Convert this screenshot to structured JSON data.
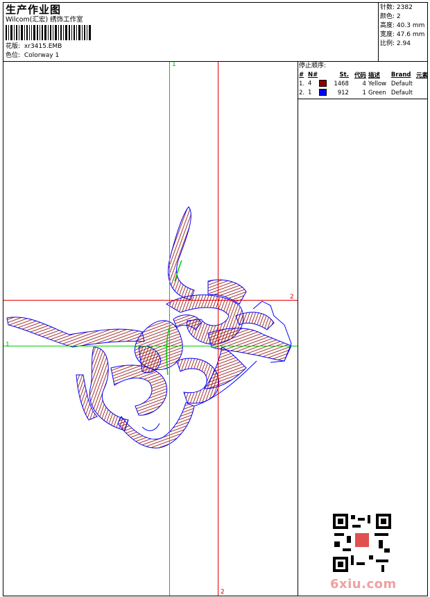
{
  "header": {
    "title": "生产作业图",
    "company": "Wilcom(汇宏) 绣饰工作室",
    "design_label": "花版:",
    "design_file": "xr3415.EMB",
    "colorway_label": "色位:",
    "colorway": "Colorway 1"
  },
  "stats": {
    "stitches_label": "针数:",
    "stitches": "2382",
    "colors_label": "颜色:",
    "colors": "2",
    "height_label": "高度:",
    "height": "40.3 mm",
    "width_label": "宽度:",
    "width": "47.6 mm",
    "scale_label": "比例:",
    "scale": "2.94"
  },
  "stop_sequence": {
    "heading": "停止顺序:",
    "columns": [
      "#",
      "N#",
      "St.",
      "代码",
      "描述",
      "Brand",
      "元素"
    ],
    "rows": [
      {
        "num": "1.",
        "n": "4",
        "swatch": "#8b0000",
        "st": "1468",
        "code": "4",
        "desc": "Yellow",
        "brand": "Default"
      },
      {
        "num": "2.",
        "n": "1",
        "swatch": "#0000ff",
        "st": "912",
        "code": "1",
        "desc": "Green",
        "brand": "Default"
      }
    ]
  },
  "axes": {
    "green_top": "1",
    "green_left": "1",
    "red_right": "2",
    "red_bottom": "2"
  },
  "colors": {
    "stitch_red": "#8b0000",
    "outline_blue": "#0000ff",
    "axis_green": "#00cc00",
    "axis_red": "#e00000"
  },
  "watermark": {
    "site": "6xiu.com"
  }
}
